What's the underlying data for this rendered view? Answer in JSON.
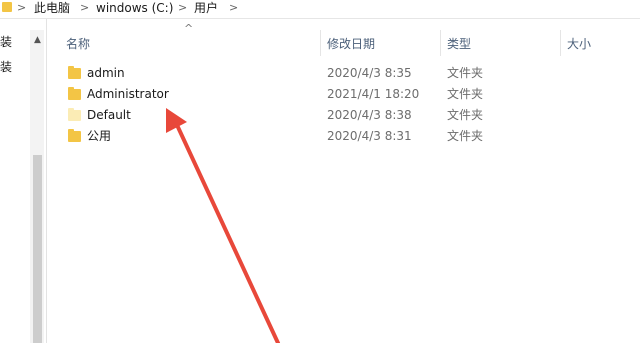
{
  "breadcrumb": {
    "items": [
      "此电脑",
      "windows (C:)",
      "用户"
    ],
    "separator": ">"
  },
  "nav": {
    "items": [
      "安装",
      "安装"
    ],
    "scroll_up_icon": "chevron-up-icon"
  },
  "columns": {
    "name": "名称",
    "modified": "修改日期",
    "type": "类型",
    "size": "大小",
    "sort_indicator": "^"
  },
  "rows": [
    {
      "name": "admin",
      "modified": "2020/4/3 8:35",
      "type": "文件夹",
      "icon_color": "#f3c545"
    },
    {
      "name": "Administrator",
      "modified": "2021/4/1 18:20",
      "type": "文件夹",
      "icon_color": "#f3c545"
    },
    {
      "name": "Default",
      "modified": "2020/4/3 8:38",
      "type": "文件夹",
      "icon_color": "#fbecb5"
    },
    {
      "name": "公用",
      "modified": "2020/4/3 8:31",
      "type": "文件夹",
      "icon_color": "#f3c545"
    }
  ],
  "annotation": {
    "arrow_color": "#e8483a",
    "target": "Administrator"
  }
}
